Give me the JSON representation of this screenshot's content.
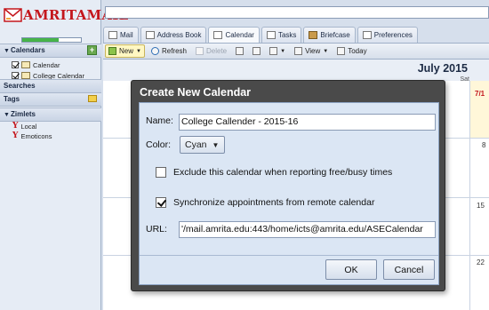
{
  "app": {
    "logo_text": "AMRITAMAIL",
    "quota_percent": 62
  },
  "sidebar": {
    "calendars_header": "Calendars",
    "calendars": [
      {
        "label": "Calendar",
        "color": "#f6e9b6"
      },
      {
        "label": "College Calendar",
        "color": "#f6e9b6"
      }
    ],
    "searches_header": "Searches",
    "tags_header": "Tags",
    "zimlets_header": "Zimlets",
    "zimlets": [
      {
        "label": "Local",
        "icon": "yahoo-icon"
      },
      {
        "label": "Emoticons",
        "icon": "yahoo-icon"
      }
    ]
  },
  "tabs": [
    {
      "label": "Mail",
      "icon": "mail-icon"
    },
    {
      "label": "Address Book",
      "icon": "address-book-icon"
    },
    {
      "label": "Calendar",
      "icon": "calendar-icon",
      "active": true
    },
    {
      "label": "Tasks",
      "icon": "tasks-icon"
    },
    {
      "label": "Briefcase",
      "icon": "briefcase-icon"
    },
    {
      "label": "Preferences",
      "icon": "preferences-icon"
    }
  ],
  "toolbar": {
    "new_label": "New",
    "refresh_label": "Refresh",
    "delete_label": "Delete",
    "view_label": "View",
    "today_label": "Today"
  },
  "calendar": {
    "month_title": "July 2015",
    "day_header": "Sat",
    "dates": [
      "7/1",
      "8",
      "15",
      "22"
    ]
  },
  "dialog": {
    "title": "Create New Calendar",
    "name_label": "Name:",
    "name_value": "College Callender - 2015-16",
    "color_label": "Color:",
    "color_value": "Cyan",
    "exclude_label": "Exclude this calendar when reporting free/busy times",
    "exclude_checked": false,
    "sync_label": "Synchronize appointments from remote calendar",
    "sync_checked": true,
    "url_label": "URL:",
    "url_value": "'/mail.amrita.edu:443/home/icts@amrita.edu/ASECalendar",
    "ok_label": "OK",
    "cancel_label": "Cancel"
  }
}
